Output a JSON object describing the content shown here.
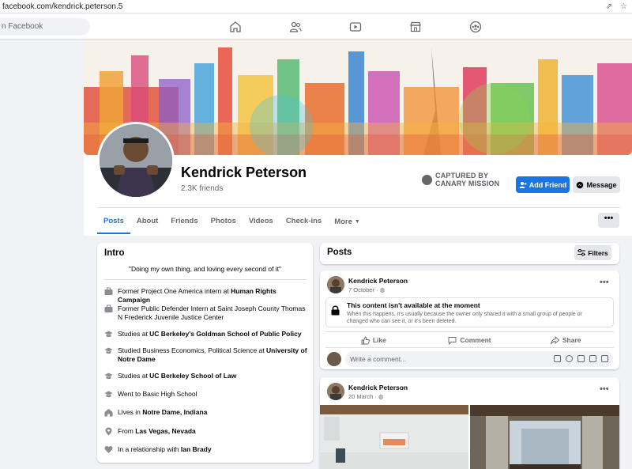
{
  "browser": {
    "url": "facebook.com/kendrick.peterson.5",
    "share_icon": "share-icon",
    "star_icon": "star-icon"
  },
  "topnav": {
    "search_placeholder": "n Facebook",
    "icons": [
      "home-icon",
      "friends-icon",
      "watch-icon",
      "marketplace-icon",
      "groups-icon"
    ]
  },
  "profile": {
    "name": "Kendrick Peterson",
    "friends": "2.3K friends",
    "captured_line1": "CAPTURED BY",
    "captured_line2": "CANARY MISSION",
    "add_friend": "Add Friend",
    "message": "Message"
  },
  "tabs": [
    "Posts",
    "About",
    "Friends",
    "Photos",
    "Videos",
    "Check-ins",
    "More"
  ],
  "more_button": "•••",
  "intro": {
    "title": "Intro",
    "bio": "\"Doing my own thing, and loving every second of it\"",
    "items": [
      {
        "icon": "work-icon",
        "text": "Former Project One America intern at ",
        "bold": "Human Rights Campaign"
      },
      {
        "icon": "work-icon",
        "text": "Former Public Defender Intern at Saint Joseph County Thomas N Frederick Juvenile Justice Center",
        "bold": ""
      },
      {
        "icon": "school-icon",
        "text": "Studies at ",
        "bold": "UC Berkeley's Goldman School of Public Policy"
      },
      {
        "icon": "school-icon",
        "text": "Studied Business Economics, Political Science at ",
        "bold": "University of Notre Dame"
      },
      {
        "icon": "school-icon",
        "text": "Studies at ",
        "bold": "UC Berkeley School of Law"
      },
      {
        "icon": "school-icon",
        "text": "Went to Basic High School",
        "bold": ""
      },
      {
        "icon": "home-icon",
        "text": "Lives in ",
        "bold": "Notre Dame, Indiana"
      },
      {
        "icon": "location-icon",
        "text": "From ",
        "bold": "Las Vegas, Nevada"
      },
      {
        "icon": "heart-icon",
        "text": "In a relationship with ",
        "bold": "Ian Brady"
      }
    ]
  },
  "posts": {
    "title": "Posts",
    "filters": "Filters",
    "post1": {
      "author": "Kendrick Peterson",
      "date": "7 October · ",
      "unavailable_title": "This content isn't available at the moment",
      "unavailable_desc": "When this happens, it's usually because the owner only shared it with a small group of people or changed who can see it, or it's been deleted.",
      "like": "Like",
      "comment": "Comment",
      "share": "Share",
      "comment_placeholder": "Write a comment..."
    },
    "post2": {
      "author": "Kendrick Peterson",
      "date": "20 March · "
    }
  },
  "colors": {
    "accent": "#1b74e4",
    "background": "#f0f2f5",
    "secondary_text": "#65676b"
  }
}
